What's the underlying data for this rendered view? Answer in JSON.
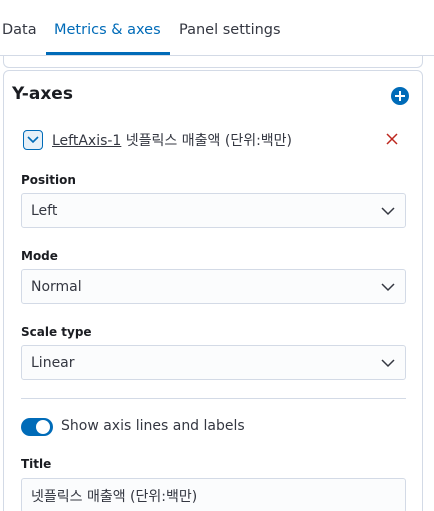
{
  "tabs": [
    {
      "label": "Data",
      "active": false
    },
    {
      "label": "Metrics & axes",
      "active": true
    },
    {
      "label": "Panel settings",
      "active": false
    }
  ],
  "section": {
    "title": "Y-axes",
    "add_icon": "plus-circle-icon"
  },
  "axis": {
    "name": "LeftAxis-1",
    "title_preview": "넷플릭스 매출액 (단위:백만)",
    "toggle_icon": "chevron-down-icon",
    "remove_icon": "close-icon"
  },
  "fields": {
    "position": {
      "label": "Position",
      "value": "Left"
    },
    "mode": {
      "label": "Mode",
      "value": "Normal"
    },
    "scale_type": {
      "label": "Scale type",
      "value": "Linear"
    },
    "show_axis": {
      "label": "Show axis lines and labels",
      "enabled": true
    },
    "title": {
      "label": "Title",
      "value": "넷플릭스 매출액 (단위:백만)"
    }
  },
  "colors": {
    "accent": "#006bb8",
    "remove": "#bd271e",
    "border": "#d3dae6"
  }
}
